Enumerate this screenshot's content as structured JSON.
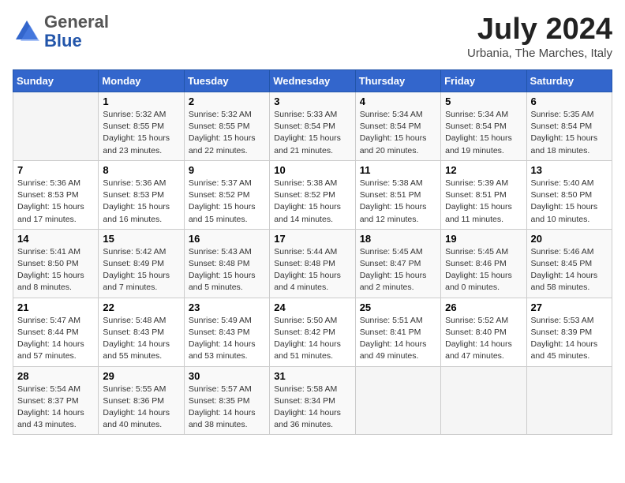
{
  "header": {
    "logo_general": "General",
    "logo_blue": "Blue",
    "month_year": "July 2024",
    "location": "Urbania, The Marches, Italy"
  },
  "days_of_week": [
    "Sunday",
    "Monday",
    "Tuesday",
    "Wednesday",
    "Thursday",
    "Friday",
    "Saturday"
  ],
  "weeks": [
    [
      {
        "empty": true
      },
      {
        "day": "1",
        "sunrise": "5:32 AM",
        "sunset": "8:55 PM",
        "daylight": "15 hours and 23 minutes."
      },
      {
        "day": "2",
        "sunrise": "5:32 AM",
        "sunset": "8:55 PM",
        "daylight": "15 hours and 22 minutes."
      },
      {
        "day": "3",
        "sunrise": "5:33 AM",
        "sunset": "8:54 PM",
        "daylight": "15 hours and 21 minutes."
      },
      {
        "day": "4",
        "sunrise": "5:34 AM",
        "sunset": "8:54 PM",
        "daylight": "15 hours and 20 minutes."
      },
      {
        "day": "5",
        "sunrise": "5:34 AM",
        "sunset": "8:54 PM",
        "daylight": "15 hours and 19 minutes."
      },
      {
        "day": "6",
        "sunrise": "5:35 AM",
        "sunset": "8:54 PM",
        "daylight": "15 hours and 18 minutes."
      }
    ],
    [
      {
        "day": "7",
        "sunrise": "5:36 AM",
        "sunset": "8:53 PM",
        "daylight": "15 hours and 17 minutes."
      },
      {
        "day": "8",
        "sunrise": "5:36 AM",
        "sunset": "8:53 PM",
        "daylight": "15 hours and 16 minutes."
      },
      {
        "day": "9",
        "sunrise": "5:37 AM",
        "sunset": "8:52 PM",
        "daylight": "15 hours and 15 minutes."
      },
      {
        "day": "10",
        "sunrise": "5:38 AM",
        "sunset": "8:52 PM",
        "daylight": "15 hours and 14 minutes."
      },
      {
        "day": "11",
        "sunrise": "5:38 AM",
        "sunset": "8:51 PM",
        "daylight": "15 hours and 12 minutes."
      },
      {
        "day": "12",
        "sunrise": "5:39 AM",
        "sunset": "8:51 PM",
        "daylight": "15 hours and 11 minutes."
      },
      {
        "day": "13",
        "sunrise": "5:40 AM",
        "sunset": "8:50 PM",
        "daylight": "15 hours and 10 minutes."
      }
    ],
    [
      {
        "day": "14",
        "sunrise": "5:41 AM",
        "sunset": "8:50 PM",
        "daylight": "15 hours and 8 minutes."
      },
      {
        "day": "15",
        "sunrise": "5:42 AM",
        "sunset": "8:49 PM",
        "daylight": "15 hours and 7 minutes."
      },
      {
        "day": "16",
        "sunrise": "5:43 AM",
        "sunset": "8:48 PM",
        "daylight": "15 hours and 5 minutes."
      },
      {
        "day": "17",
        "sunrise": "5:44 AM",
        "sunset": "8:48 PM",
        "daylight": "15 hours and 4 minutes."
      },
      {
        "day": "18",
        "sunrise": "5:45 AM",
        "sunset": "8:47 PM",
        "daylight": "15 hours and 2 minutes."
      },
      {
        "day": "19",
        "sunrise": "5:45 AM",
        "sunset": "8:46 PM",
        "daylight": "15 hours and 0 minutes."
      },
      {
        "day": "20",
        "sunrise": "5:46 AM",
        "sunset": "8:45 PM",
        "daylight": "14 hours and 58 minutes."
      }
    ],
    [
      {
        "day": "21",
        "sunrise": "5:47 AM",
        "sunset": "8:44 PM",
        "daylight": "14 hours and 57 minutes."
      },
      {
        "day": "22",
        "sunrise": "5:48 AM",
        "sunset": "8:43 PM",
        "daylight": "14 hours and 55 minutes."
      },
      {
        "day": "23",
        "sunrise": "5:49 AM",
        "sunset": "8:43 PM",
        "daylight": "14 hours and 53 minutes."
      },
      {
        "day": "24",
        "sunrise": "5:50 AM",
        "sunset": "8:42 PM",
        "daylight": "14 hours and 51 minutes."
      },
      {
        "day": "25",
        "sunrise": "5:51 AM",
        "sunset": "8:41 PM",
        "daylight": "14 hours and 49 minutes."
      },
      {
        "day": "26",
        "sunrise": "5:52 AM",
        "sunset": "8:40 PM",
        "daylight": "14 hours and 47 minutes."
      },
      {
        "day": "27",
        "sunrise": "5:53 AM",
        "sunset": "8:39 PM",
        "daylight": "14 hours and 45 minutes."
      }
    ],
    [
      {
        "day": "28",
        "sunrise": "5:54 AM",
        "sunset": "8:37 PM",
        "daylight": "14 hours and 43 minutes."
      },
      {
        "day": "29",
        "sunrise": "5:55 AM",
        "sunset": "8:36 PM",
        "daylight": "14 hours and 40 minutes."
      },
      {
        "day": "30",
        "sunrise": "5:57 AM",
        "sunset": "8:35 PM",
        "daylight": "14 hours and 38 minutes."
      },
      {
        "day": "31",
        "sunrise": "5:58 AM",
        "sunset": "8:34 PM",
        "daylight": "14 hours and 36 minutes."
      },
      {
        "empty": true
      },
      {
        "empty": true
      },
      {
        "empty": true
      }
    ]
  ]
}
